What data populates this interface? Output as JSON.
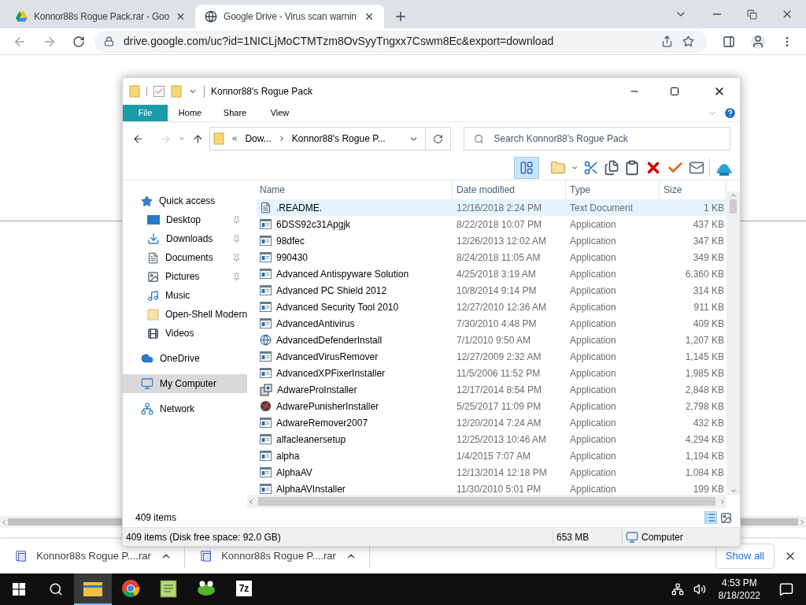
{
  "browser": {
    "tabs": [
      {
        "title": "Konnor88s Rogue Pack.rar - Goo",
        "kind": "drive",
        "selected": false
      },
      {
        "title": "Google Drive - Virus scan warnin",
        "kind": "globe",
        "selected": true
      }
    ],
    "url": "drive.google.com/uc?id=1NICLjMoCTMTzm8OvSyyTngxx7Cswm8Ec&export=download"
  },
  "explorer": {
    "title": "Konnor88's Rogue Pack",
    "ribbon_tabs": [
      {
        "label": "File",
        "selected": true
      },
      {
        "label": "Home",
        "selected": false
      },
      {
        "label": "Share",
        "selected": false
      },
      {
        "label": "View",
        "selected": false
      }
    ],
    "breadcrumb": [
      "Dow...",
      "Konnor88's Rogue P..."
    ],
    "search": {
      "placeholder": "Search Konnor88's Rogue Pack"
    },
    "columns": [
      "Name",
      "Date modified",
      "Type",
      "Size"
    ],
    "sidebar": [
      {
        "label": "Quick access",
        "kind": "star",
        "selected": false,
        "children": [
          {
            "label": "Desktop",
            "kind": "desktop",
            "pinned": true,
            "selected": false
          },
          {
            "label": "Downloads",
            "kind": "download",
            "pinned": true,
            "selected": false
          },
          {
            "label": "Documents",
            "kind": "document",
            "pinned": true,
            "selected": false
          },
          {
            "label": "Pictures",
            "kind": "pictures",
            "pinned": true,
            "selected": false
          },
          {
            "label": "Music",
            "kind": "music",
            "pinned": false,
            "selected": false
          },
          {
            "label": "Open-Shell Modern",
            "kind": "folder",
            "pinned": false,
            "selected": false
          },
          {
            "label": "Videos",
            "kind": "video",
            "pinned": false,
            "selected": false
          }
        ]
      },
      {
        "label": "OneDrive",
        "kind": "cloud",
        "selected": false
      },
      {
        "label": "My Computer",
        "kind": "computer",
        "selected": true
      },
      {
        "label": "Network",
        "kind": "network",
        "selected": false
      }
    ],
    "rows": [
      {
        "name": ".README.",
        "date": "12/16/2018 2:24 PM",
        "type": "Text Document",
        "size": "1 KB",
        "kind": "document",
        "selected": true
      },
      {
        "name": "6DSS92c31Apgjk",
        "date": "8/22/2018 10:07 PM",
        "type": "Application",
        "size": "437 KB",
        "kind": "app",
        "selected": false
      },
      {
        "name": "98dfec",
        "date": "12/26/2013 12:02 AM",
        "type": "Application",
        "size": "347 KB",
        "kind": "app",
        "selected": false
      },
      {
        "name": "990430",
        "date": "8/24/2018 11:05 AM",
        "type": "Application",
        "size": "349 KB",
        "kind": "app",
        "selected": false
      },
      {
        "name": "Advanced Antispyware Solution",
        "date": "4/25/2018 3:19 AM",
        "type": "Application",
        "size": "6,360 KB",
        "kind": "app",
        "selected": false
      },
      {
        "name": "Advanced PC Shield 2012",
        "date": "10/8/2014 9:14 PM",
        "type": "Application",
        "size": "314 KB",
        "kind": "app",
        "selected": false
      },
      {
        "name": "Advanced Security Tool 2010",
        "date": "12/27/2010 12:36 AM",
        "type": "Application",
        "size": "911 KB",
        "kind": "app",
        "selected": false
      },
      {
        "name": "AdvancedAntivirus",
        "date": "7/30/2010 4:48 PM",
        "type": "Application",
        "size": "409 KB",
        "kind": "app",
        "selected": false
      },
      {
        "name": "AdvancedDefenderInstall",
        "date": "7/1/2010 9:50 AM",
        "type": "Application",
        "size": "1,207 KB",
        "kind": "globe",
        "selected": false
      },
      {
        "name": "AdvancedVirusRemover",
        "date": "12/27/2009 2:32 AM",
        "type": "Application",
        "size": "1,145 KB",
        "kind": "app",
        "selected": false
      },
      {
        "name": "AdvancedXPFixerInstaller",
        "date": "11/5/2006 11:52 PM",
        "type": "Application",
        "size": "1,985 KB",
        "kind": "app",
        "selected": false
      },
      {
        "name": "AdwareProInstaller",
        "date": "12/17/2014 8:54 PM",
        "type": "Application",
        "size": "2,848 KB",
        "kind": "installer",
        "selected": false
      },
      {
        "name": "AdwarePunisherInstaller",
        "date": "5/25/2017 11:09 PM",
        "type": "Application",
        "size": "2,798 KB",
        "kind": "ball",
        "selected": false
      },
      {
        "name": "AdwareRemover2007",
        "date": "12/20/2014 7:24 AM",
        "type": "Application",
        "size": "432 KB",
        "kind": "app",
        "selected": false
      },
      {
        "name": "alfacleanersetup",
        "date": "12/25/2013 10:46 AM",
        "type": "Application",
        "size": "4,294 KB",
        "kind": "app",
        "selected": false
      },
      {
        "name": "alpha",
        "date": "1/4/2015 7:07 AM",
        "type": "Application",
        "size": "1,194 KB",
        "kind": "app",
        "selected": false
      },
      {
        "name": "AlphaAV",
        "date": "12/13/2014 12:18 PM",
        "type": "Application",
        "size": "1,084 KB",
        "kind": "app",
        "selected": false
      },
      {
        "name": "AlphaAVInstaller",
        "date": "11/30/2010 5:01 PM",
        "type": "Application",
        "size": "199 KB",
        "kind": "app",
        "selected": false
      }
    ],
    "item_count": "409 items",
    "status": {
      "summary": "409 items (Disk free space: 92.0 GB)",
      "size": "653 MB",
      "location": "Computer"
    }
  },
  "downloads": [
    {
      "name": "Konnor88s Rogue P....rar"
    },
    {
      "name": "Konnor88s Rogue P....rar"
    }
  ],
  "show_all": "Show all",
  "taskbar": {
    "apps": [
      {
        "kind": "explorer",
        "selected": true
      },
      {
        "kind": "chrome",
        "selected": false
      },
      {
        "kind": "notepad",
        "selected": false
      },
      {
        "kind": "frog",
        "selected": false
      },
      {
        "kind": "archive",
        "label": "7z",
        "selected": false
      }
    ],
    "time": "4:53 PM",
    "date": "8/18/2022"
  }
}
